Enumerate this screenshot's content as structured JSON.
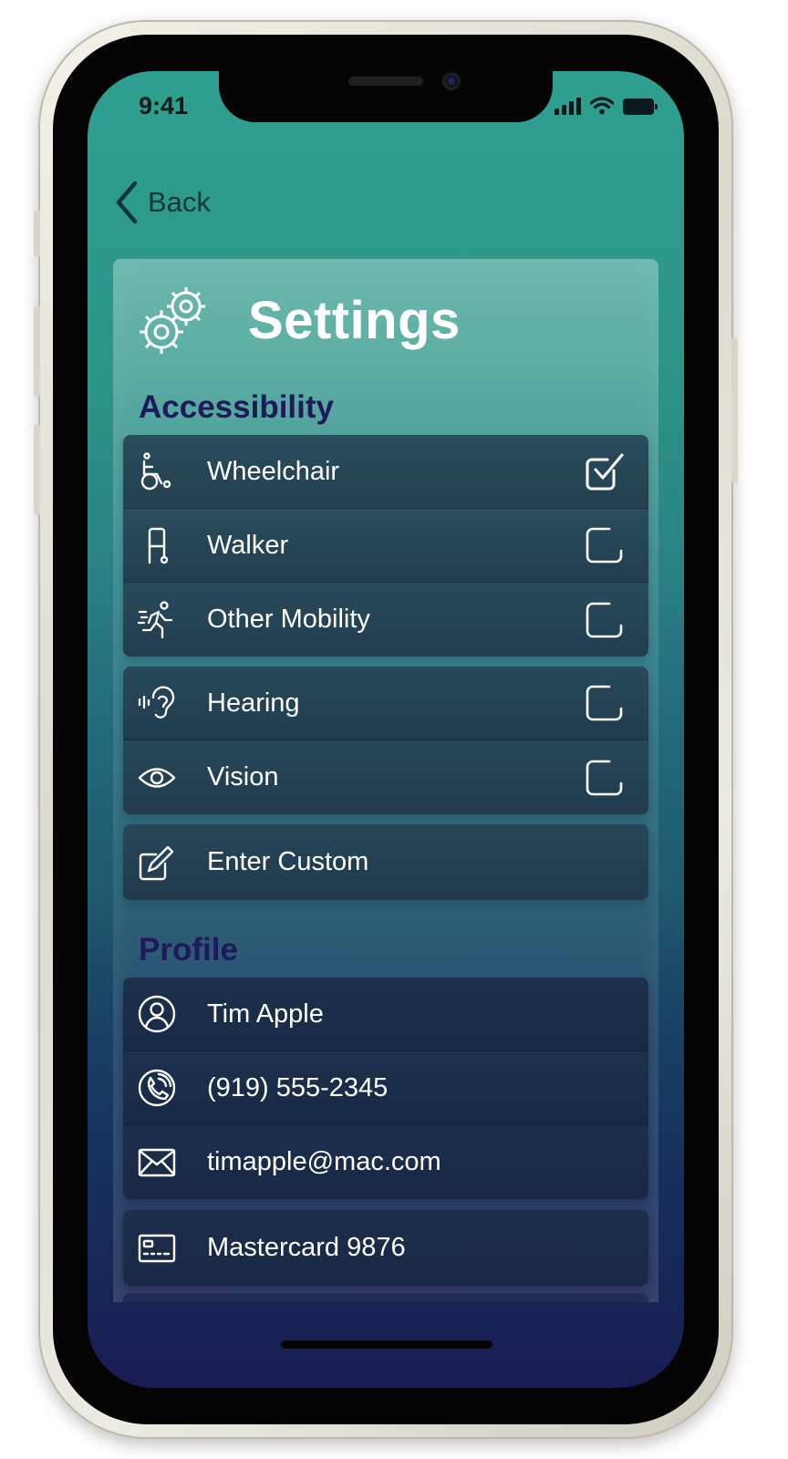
{
  "status_bar": {
    "time": "9:41"
  },
  "nav": {
    "back_label": "Back"
  },
  "page": {
    "title": "Settings"
  },
  "accessibility": {
    "heading": "Accessibility",
    "mobility_items": [
      {
        "label": "Wheelchair",
        "icon": "wheelchair-icon",
        "checked": true
      },
      {
        "label": "Walker",
        "icon": "walker-icon",
        "checked": false
      },
      {
        "label": "Other Mobility",
        "icon": "running-person-icon",
        "checked": false
      }
    ],
    "sensory_items": [
      {
        "label": "Hearing",
        "icon": "ear-icon",
        "checked": false
      },
      {
        "label": "Vision",
        "icon": "eye-icon",
        "checked": false
      }
    ],
    "custom": {
      "label": "Enter Custom",
      "icon": "edit-icon"
    }
  },
  "profile": {
    "heading": "Profile",
    "items": [
      {
        "label": "Tim Apple",
        "icon": "person-icon"
      },
      {
        "label": "(919) 555-2345",
        "icon": "phone-icon"
      },
      {
        "label": "timapple@mac.com",
        "icon": "mail-icon"
      }
    ],
    "payment": {
      "label": "Mastercard 9876",
      "icon": "credit-card-icon"
    }
  },
  "colors": {
    "teal_top": "#2e9f90",
    "navy_bottom": "#181c52",
    "section_heading": "#1e1a5c",
    "row_text": "#ffffff"
  }
}
